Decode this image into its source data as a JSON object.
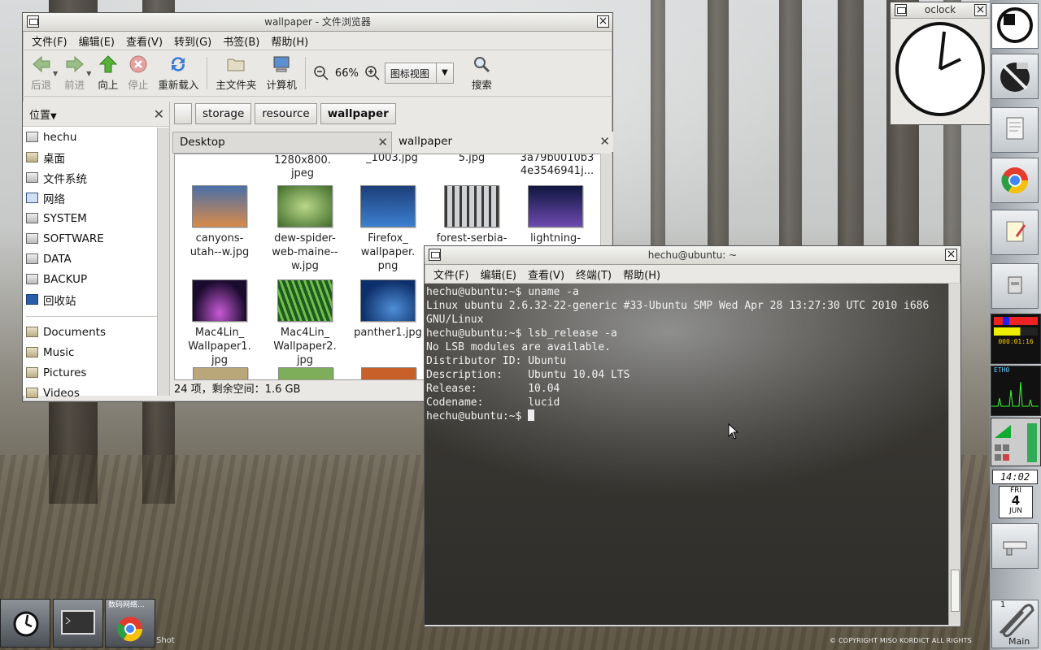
{
  "file_manager": {
    "title": "wallpaper - 文件浏览器",
    "menu": [
      "文件(F)",
      "编辑(E)",
      "查看(V)",
      "转到(G)",
      "书签(B)",
      "帮助(H)"
    ],
    "toolbar": {
      "back": "后退",
      "forward": "前进",
      "up": "向上",
      "stop": "停止",
      "reload": "重新载入",
      "home": "主文件夹",
      "computer": "计算机",
      "zoom": "66%",
      "view_mode": "图标视图",
      "search": "搜索"
    },
    "sidebar": {
      "header": "位置",
      "places": [
        "hechu",
        "桌面",
        "文件系统",
        "网络",
        "SYSTEM",
        "SOFTWARE",
        "DATA",
        "BACKUP",
        "回收站"
      ],
      "bookmarks": [
        "Documents",
        "Music",
        "Pictures",
        "Videos"
      ]
    },
    "path": [
      "storage",
      "resource",
      "wallpaper"
    ],
    "tabs": [
      "Desktop",
      "wallpaper"
    ],
    "cut_labels": [
      "1280x800.\njpeg",
      "_1003.jpg",
      "5.jpg",
      "3a79b0010b3\n4e3546941j..."
    ],
    "files": [
      {
        "name": "canyons-\nutah--w.jpg",
        "color_a": "#d98a4a",
        "color_b": "#4a6fa8"
      },
      {
        "name": "dew-spider-\nweb-maine--\nw.jpg",
        "color_a": "#3f6b2a",
        "color_b": "#b9d88a"
      },
      {
        "name": "Firefox_\nwallpaper.\npng",
        "color_a": "#1d3f7a",
        "color_b": "#3c7fd0"
      },
      {
        "name": "forest-serbia-",
        "color_a": "#cfd3d8",
        "color_b": "#3d3a36"
      },
      {
        "name": "lightning-",
        "color_a": "#10163f",
        "color_b": "#6d4ab0"
      },
      {
        "name": "Mac4Lin_\nWallpaper1.\njpg",
        "color_a": "#1b0b2e",
        "color_b": "#c85ad6"
      },
      {
        "name": "Mac4Lin_\nWallpaper2.\njpg",
        "color_a": "#1f5a20",
        "color_b": "#6fbf4a"
      },
      {
        "name": "panther1.jpg",
        "color_a": "#0d2f6a",
        "color_b": "#4f8fd8"
      }
    ],
    "status": "24 项，剩余空间：1.6 GB"
  },
  "terminal": {
    "title": "hechu@ubuntu: ~",
    "menu": [
      "文件(F)",
      "编辑(E)",
      "查看(V)",
      "终端(T)",
      "帮助(H)"
    ],
    "lines": [
      "hechu@ubuntu:~$ uname -a",
      "Linux ubuntu 2.6.32-22-generic #33-Ubuntu SMP Wed Apr 28 13:27:30 UTC 2010 i686",
      "GNU/Linux",
      "hechu@ubuntu:~$ lsb_release -a",
      "No LSB modules are available.",
      "Distributor ID: Ubuntu",
      "Description:    Ubuntu 10.04 LTS",
      "Release:        10.04",
      "Codename:       lucid"
    ],
    "prompt": "hechu@ubuntu:~$ "
  },
  "oclock": {
    "title": "oclock"
  },
  "dock": {
    "monitor_time": "000:01:16",
    "net_label": "ETH0",
    "clock_time": "14:02",
    "date_day": "FRI",
    "date_num": "4",
    "date_month": "JUN",
    "pager_label": "1",
    "main_label": "Main"
  },
  "taskbar": {
    "label": "数码网络..."
  },
  "desktop": {
    "copyright": "© COPYRIGHT MISO KORDICT  ALL RIGHTS",
    "shot_label": "Shot"
  }
}
